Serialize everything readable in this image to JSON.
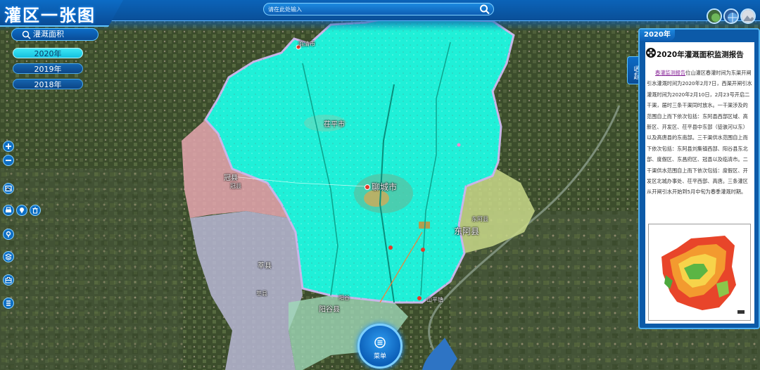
{
  "header": {
    "app_title": "灌区一张图",
    "search": {
      "placeholder": "请在此处输入"
    },
    "top_icons": [
      "satellite-icon",
      "globe-icon",
      "terrain-icon"
    ]
  },
  "left_panel": {
    "feature_tab": "灌溉面积",
    "years": [
      {
        "label": "2020年",
        "active": true
      },
      {
        "label": "2019年",
        "active": false
      },
      {
        "label": "2018年",
        "active": false
      }
    ],
    "tools": [
      "zoom-in",
      "zoom-out",
      "layers",
      "print",
      "locate",
      "measure",
      "marker",
      "stack",
      "toolbox",
      "list"
    ]
  },
  "map": {
    "labels": [
      {
        "text": "临清市",
        "kind": "small"
      },
      {
        "text": "茌平市",
        "kind": "normal"
      },
      {
        "text": "聊城市",
        "kind": "big"
      },
      {
        "text": "冠县",
        "kind": "normal"
      },
      {
        "text": "冠县",
        "kind": "small"
      },
      {
        "text": "东阿县",
        "kind": "big"
      },
      {
        "text": "东阿县",
        "kind": "small"
      },
      {
        "text": "莘县",
        "kind": "normal"
      },
      {
        "text": "阳谷县",
        "kind": "normal"
      },
      {
        "text": "阳谷",
        "kind": "small"
      },
      {
        "text": "莘县",
        "kind": "small"
      },
      {
        "text": "山平镇",
        "kind": "small"
      }
    ],
    "colors": {
      "irrigated": "#1ff0d8",
      "irrigated_dark": "#17c9b5",
      "county_pink": "#e6a7b0",
      "county_lavender": "#b9b9d6",
      "county_green": "#9fd8b8",
      "county_olive": "#c9d98a",
      "boundary": "#c8b6e8"
    }
  },
  "report": {
    "collapse_label": "收起",
    "year_tab": "2020年",
    "title": "2020年灌溉面积监测报告",
    "highlight": "春灌监测报告",
    "text": "位山灌区春灌时间为东渠开闸引水灌溉时间为2020年2月7日，西渠开闸引水灌溉时间为2020年2月10日，2月23号开启二干渠，届时三条干渠同时放水。一干渠涉及的范围自上而下依次包括：东阿县西部区域、高新区、开发区、茌平县中东部（徒骇河以东）以及高唐县的东南部。三干渠供水范围自上而下依次包括：东阿县刘集镇西部、阳谷县东北部、度假区、东昌府区、冠县以及临清市。二干渠供水范围自上而下依次包括：度假区、开发区北城办事处、茌平西部、高唐。三条灌区从开闸引水开始到5月中旬为春季灌溉时期。"
  },
  "menu": {
    "label": "菜单"
  }
}
